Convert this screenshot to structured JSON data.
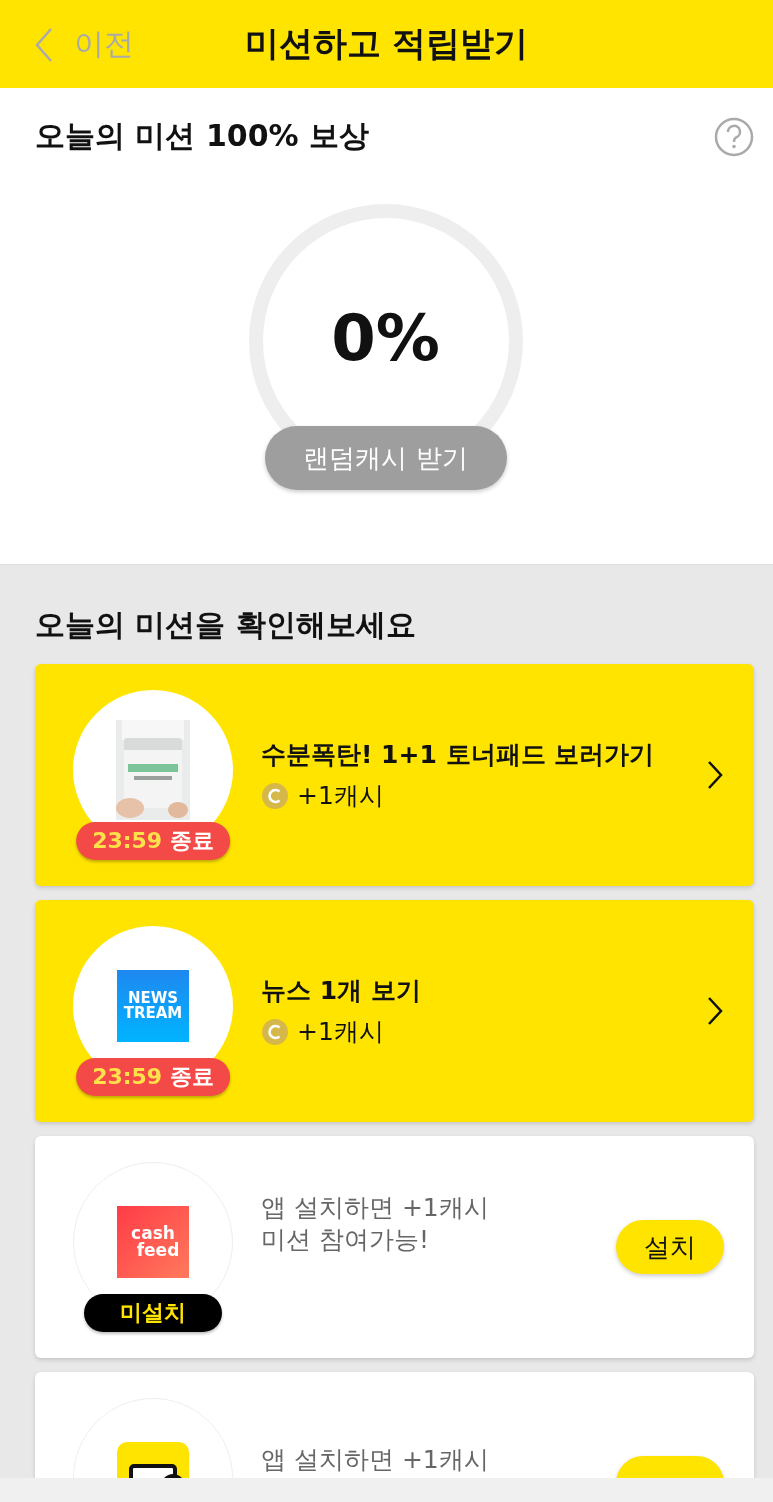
{
  "header": {
    "back": "이전",
    "title": "미션하고 적립받기"
  },
  "reward": {
    "title": "오늘의 미션 100% 보상",
    "percent": "0%",
    "button": {
      "label": "랜덤캐시 받기",
      "disabled": true
    }
  },
  "missions_title": "오늘의 미션을 확인해보세요",
  "missions": [
    {
      "kind": "timed",
      "time": "23:59",
      "ends": "종료",
      "title": "수분폭탄! 1+1 토너패드 보러가기",
      "reward": "+1캐시"
    },
    {
      "kind": "timed",
      "logo": {
        "kind": "news",
        "lines": [
          "NEWS",
          "TREAM"
        ]
      },
      "time": "23:59",
      "ends": "종료",
      "title": "뉴스 1개 보기",
      "reward": "+1캐시"
    },
    {
      "kind": "install",
      "logo": {
        "kind": "cash",
        "lines": [
          "cash",
          "feed"
        ]
      },
      "status": "미설치",
      "lines": [
        "앱 설치하면 +1캐시",
        "미션 참여가능!"
      ],
      "button": "설치"
    },
    {
      "kind": "install",
      "logo": {
        "kind": "wallet"
      },
      "lines": [
        "앱 설치하면 +1캐시"
      ]
    }
  ]
}
